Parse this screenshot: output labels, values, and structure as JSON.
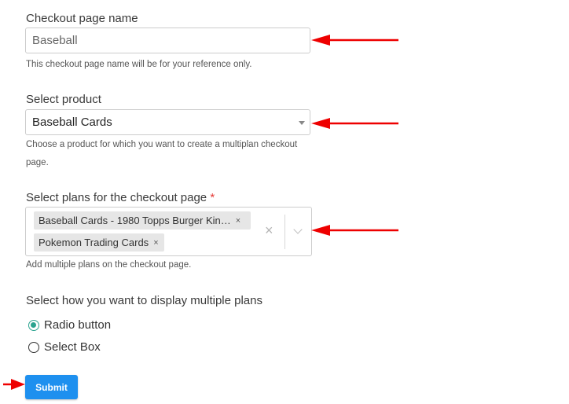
{
  "checkout_name": {
    "label": "Checkout page name",
    "value": "Baseball",
    "help": "This checkout page name will be for your reference only."
  },
  "product": {
    "label": "Select product",
    "selected": "Baseball Cards",
    "help": "Choose a product for which you want to create a multiplan checkout page."
  },
  "plans": {
    "label": "Select plans for the checkout page",
    "required_mark": "*",
    "tags": [
      {
        "text": "Baseball Cards - 1980 Topps Burger Kin…",
        "remove": "×"
      },
      {
        "text": "Pokemon Trading Cards",
        "remove": "×"
      }
    ],
    "clear": "×",
    "help": "Add multiple plans on the checkout page."
  },
  "display": {
    "label": "Select how you want to display multiple plans",
    "options": [
      {
        "label": "Radio button",
        "checked": true
      },
      {
        "label": "Select Box",
        "checked": false
      }
    ]
  },
  "submit_label": "Submit",
  "annotation_color": "#ee0000",
  "accent_color": "#1e90ef"
}
